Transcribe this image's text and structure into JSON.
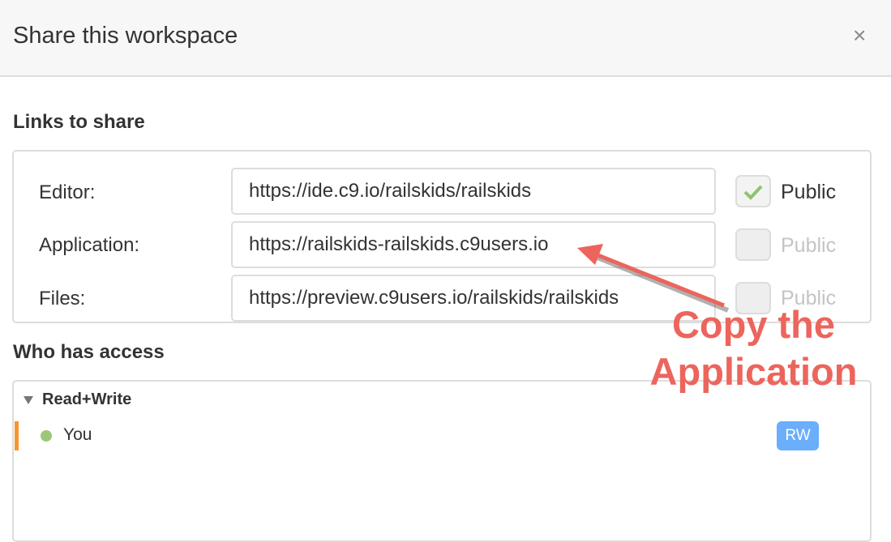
{
  "dialog": {
    "title": "Share this workspace",
    "close_icon": "close-icon"
  },
  "links": {
    "heading": "Links to share",
    "rows": [
      {
        "label": "Editor:",
        "url": "https://ide.c9.io/railskids/railskids",
        "public_label": "Public",
        "public": true
      },
      {
        "label": "Application:",
        "url": "https://railskids-railskids.c9users.io",
        "public_label": "Public",
        "public": false
      },
      {
        "label": "Files:",
        "url": "https://preview.c9users.io/railskids/railskids",
        "public_label": "Public",
        "public": false
      }
    ]
  },
  "access": {
    "heading": "Who has access",
    "group": "Read+Write",
    "members": [
      {
        "name": "You",
        "badge": "RW",
        "status_color": "#9bc878",
        "badge_color": "#6aaefc"
      }
    ]
  },
  "annotation": {
    "line1": "Copy the",
    "line2": "Application",
    "color": "#ec655c"
  }
}
